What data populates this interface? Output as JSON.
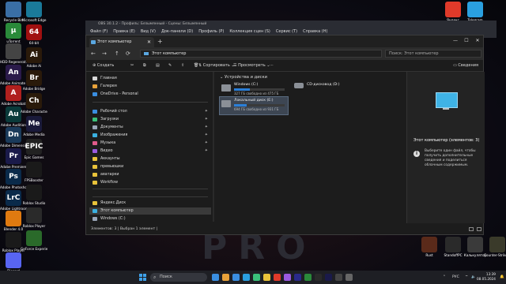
{
  "desktop_left": [
    {
      "label": "Recycle Bin",
      "color": "#3a6ea5",
      "glyph": ""
    },
    {
      "label": "uTorrent",
      "color": "#2a8a3a",
      "glyph": "µ"
    },
    {
      "label": "HDD Regenerat...",
      "color": "#444",
      "glyph": ""
    },
    {
      "label": "Adobe Animate 2022",
      "color": "#2a1a4a",
      "glyph": "An"
    },
    {
      "label": "Adobe Acrobat",
      "color": "#b0201e",
      "glyph": "A"
    },
    {
      "label": "Adobe Audition",
      "color": "#0a3a3a",
      "glyph": "Au"
    },
    {
      "label": "Adobe Dimension",
      "color": "#1a3a5a",
      "glyph": "Dn"
    },
    {
      "label": "Adobe Premiere",
      "color": "#1a1a4a",
      "glyph": "Pr"
    },
    {
      "label": "Adobe Photoshop",
      "color": "#0a2a4a",
      "glyph": "Ps"
    },
    {
      "label": "Adobe Lightroom",
      "color": "#0a2a4a",
      "glyph": "LrC"
    },
    {
      "label": "Blender 4.0",
      "color": "#e07a10",
      "glyph": ""
    },
    {
      "label": "Roblox Player",
      "color": "#1a1a1a",
      "glyph": ""
    },
    {
      "label": "Discord",
      "color": "#5865f2",
      "glyph": ""
    }
  ],
  "desktop_col2": [
    {
      "label": "Microsoft Edge",
      "color": "#1a7a9a",
      "glyph": ""
    },
    {
      "label": "64-bit",
      "color": "#a01010",
      "glyph": "64"
    },
    {
      "label": "Adobe Ai",
      "color": "#2a1a0a",
      "glyph": "Ai"
    },
    {
      "label": "Adobe Bridge",
      "color": "#2a1a0a",
      "glyph": "Br"
    },
    {
      "label": "Adobe Character",
      "color": "#2a1a0a",
      "glyph": "Ch"
    },
    {
      "label": "Adobe Media",
      "color": "#1a1a3a",
      "glyph": "Me"
    },
    {
      "label": "Epic Games",
      "color": "#222",
      "glyph": "EPIC"
    },
    {
      "label": "FPSBooster",
      "color": "#1a1a1a",
      "glyph": ""
    },
    {
      "label": "Roblox Studio",
      "color": "#1a1a1a",
      "glyph": ""
    },
    {
      "label": "Roblox Player",
      "color": "#2a2a2a",
      "glyph": ""
    },
    {
      "label": "GeForce Experience",
      "color": "#2a6a2a",
      "glyph": ""
    }
  ],
  "obs": {
    "title": "OBS 30.1.2 - Профиль: Безымянный - Сцены: Безымянный",
    "menu": [
      "Файл (F)",
      "Правка (E)",
      "Вид (V)",
      "Док-панели (D)",
      "Профиль (P)",
      "Коллекция сцен (S)",
      "Сервис (T)",
      "Справка (H)"
    ]
  },
  "explorer": {
    "tab_title": "Этот компьютер",
    "address": "Этот компьютер",
    "search_placeholder": "Поиск: Этот компьютер",
    "toolbar": {
      "create": "Создать",
      "sort": "Сортировать",
      "view": "Просмотреть",
      "more": "···",
      "details": "Сведения"
    },
    "nav_items": [
      {
        "label": "Главная",
        "color": "#d9d9d9",
        "pin": false
      },
      {
        "label": "Галерея",
        "color": "#e8a23a",
        "pin": false
      },
      {
        "label": "OneDrive - Personal",
        "color": "#3a8ee0",
        "pin": false
      },
      {
        "label": "Рабочий стол",
        "color": "#3a8ee0",
        "pin": true
      },
      {
        "label": "Загрузки",
        "color": "#3ac07a",
        "pin": true
      },
      {
        "label": "Документы",
        "color": "#9aa6b8",
        "pin": true
      },
      {
        "label": "Изображения",
        "color": "#3ab0e0",
        "pin": true
      },
      {
        "label": "Музыка",
        "color": "#e05a8a",
        "pin": true
      },
      {
        "label": "Видео",
        "color": "#9a5ae0",
        "pin": true
      },
      {
        "label": "Аккаунты",
        "color": "#e8c23a",
        "pin": false
      },
      {
        "label": "превьюшки",
        "color": "#e8c23a",
        "pin": false
      },
      {
        "label": "аватарки",
        "color": "#e8c23a",
        "pin": false
      },
      {
        "label": "Workflow",
        "color": "#e8c23a",
        "pin": false
      },
      {
        "label": "Яндекс.Диск",
        "color": "#e8c23a",
        "pin": false
      },
      {
        "label": "Этот компьютер",
        "color": "#3ab0e0",
        "pin": false
      },
      {
        "label": "Windows (C:)",
        "color": "#9aa6b8",
        "pin": false
      }
    ],
    "group_title": "Устройства и диски",
    "drives": [
      {
        "name": "Windows (C:)",
        "free": "327 ГБ свободно из 475 ГБ",
        "used_fraction": 0.31,
        "selected": false
      },
      {
        "name": "Локальный диск (E:)",
        "free": "694 ГБ свободно из 931 ГБ",
        "used_fraction": 0.25,
        "selected": true
      }
    ],
    "cd_drive": "CD-дисковод (D:)",
    "pane": {
      "title": "Этот компьютер (элементов: 3)",
      "text": "Выберите один файл, чтобы получить дополнительные сведения и поделиться облачным содержимым."
    },
    "status": "Элементов: 3  |  Выбран 1 элемент  |"
  },
  "desktop_right": [
    {
      "label": "Яндекс",
      "color": "#e03a2a",
      "glyph": ""
    },
    {
      "label": "Telegram",
      "color": "#2aa0e0",
      "glyph": ""
    },
    {
      "label": "Rust",
      "color": "#5a2a1a",
      "glyph": ""
    },
    {
      "label": "StandoffPC",
      "color": "#2a2a2a",
      "glyph": ""
    },
    {
      "label": "Калькулятор",
      "color": "#3a3a3a",
      "glyph": ""
    },
    {
      "label": "Counter-Strike 2",
      "color": "#3a3a2a",
      "glyph": ""
    }
  ],
  "desktop_bg_text": "PRO",
  "taskbar": {
    "search_placeholder": "Поиск",
    "lang": "РУС",
    "time": "13:39",
    "date": "08.05.2024",
    "apps": [
      "#3a8ee0",
      "#e8a23a",
      "#3a8ee0",
      "#2aa0e0",
      "#3ac07a",
      "#e8c23a",
      "#e03a2a",
      "#9a5ae0",
      "#2a2a8a",
      "#2a8a3a",
      "#2a2a2a",
      "#1a1a4a",
      "#444",
      "#666"
    ]
  }
}
